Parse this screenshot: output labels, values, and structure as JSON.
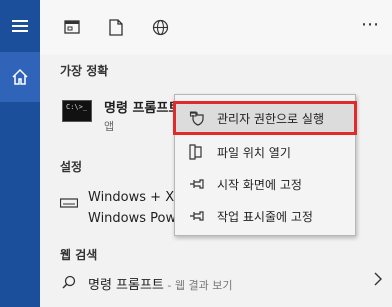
{
  "sections": {
    "best_match": "가장 정확",
    "settings": "설정",
    "web_search": "웹 검색"
  },
  "best_match_item": {
    "title": "명령 프롬프트",
    "subtitle": "앱",
    "icon": "cmd-icon",
    "icon_text": "C:\\>_"
  },
  "settings_item": {
    "line1": "Windows + X",
    "line2": "Windows PowerShell",
    "icon": "keyboard-icon"
  },
  "web_item": {
    "query": "명령 프롬프트",
    "hint": " - 웹 결과 보기",
    "icon": "search-icon"
  },
  "topbar": {
    "more_label": "⋯",
    "icons": [
      "apps-filter-icon",
      "documents-filter-icon",
      "web-filter-icon"
    ]
  },
  "context_menu": {
    "items": [
      {
        "label": "관리자 권한으로 실행",
        "icon": "shield-icon"
      },
      {
        "label": "파일 위치 열기",
        "icon": "open-file-location-icon"
      },
      {
        "label": "시작 화면에 고정",
        "icon": "pin-icon"
      },
      {
        "label": "작업 표시줄에 고정",
        "icon": "pin-icon"
      }
    ]
  },
  "colors": {
    "rail": "#1b4f9b",
    "rail_active": "#2f64b8",
    "highlight_border": "#e12a2a"
  }
}
